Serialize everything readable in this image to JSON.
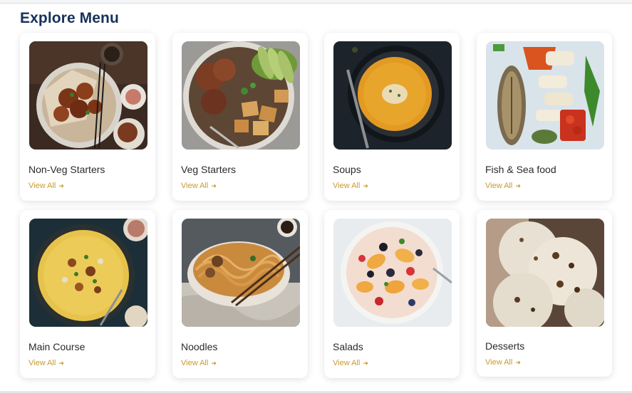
{
  "section": {
    "title": "Explore Menu"
  },
  "accent_color": "#c99a2e",
  "heading_color": "#17325a",
  "categories": [
    {
      "label": "Non-Veg Starters",
      "link": "View All",
      "arrow_icon": "arrow-right-icon",
      "image": "non-veg-starters-image"
    },
    {
      "label": "Veg Starters",
      "link": "View All",
      "arrow_icon": "arrow-right-icon",
      "image": "veg-starters-image"
    },
    {
      "label": "Soups",
      "link": "View All",
      "arrow_icon": "arrow-right-icon",
      "image": "soups-image"
    },
    {
      "label": "Fish & Sea food",
      "link": "View All",
      "arrow_icon": "arrow-right-icon",
      "image": "fish-seafood-image"
    },
    {
      "label": "Main Course",
      "link": "View All",
      "arrow_icon": "arrow-right-icon",
      "image": "main-course-image"
    },
    {
      "label": "Noodles",
      "link": "View All",
      "arrow_icon": "arrow-right-icon",
      "image": "noodles-image"
    },
    {
      "label": "Salads",
      "link": "View All",
      "arrow_icon": "arrow-right-icon",
      "image": "salads-image"
    },
    {
      "label": "Desserts",
      "link": "View All",
      "arrow_icon": "arrow-right-icon",
      "image": "desserts-image"
    }
  ]
}
